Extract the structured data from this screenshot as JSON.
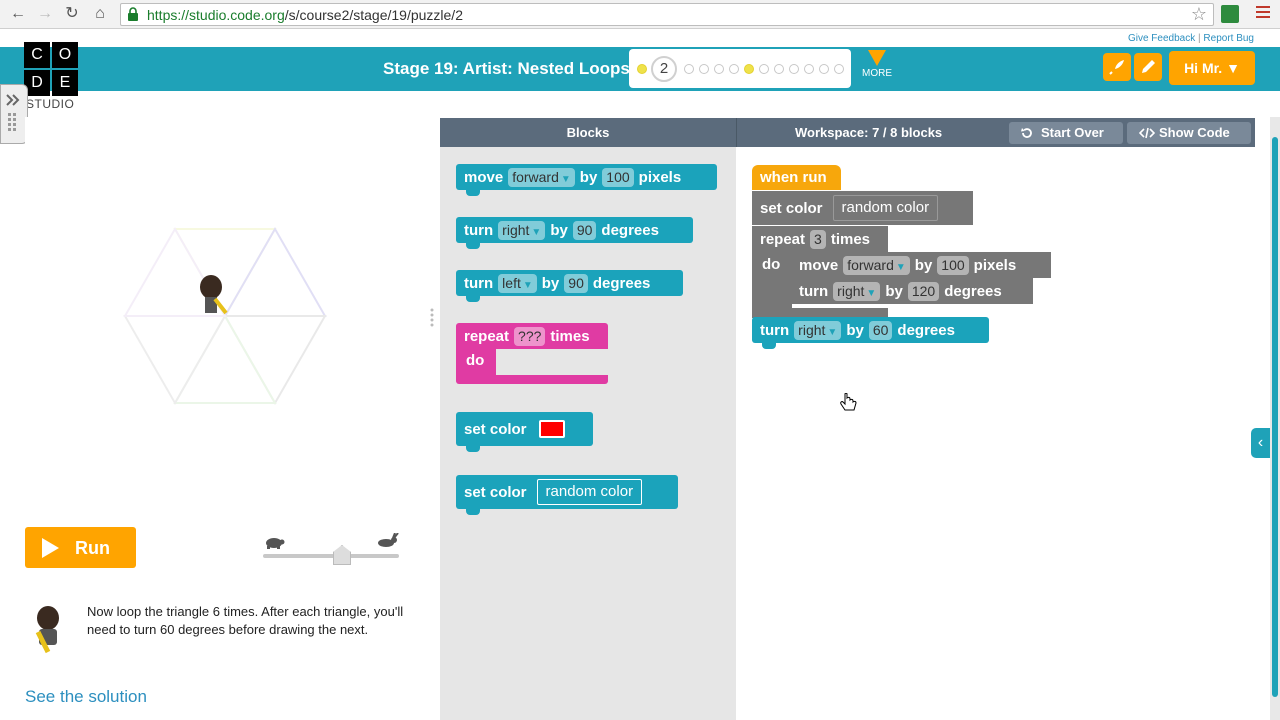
{
  "browser": {
    "url_host": "https://studio.code.org",
    "url_path": "/s/course2/stage/19/puzzle/2"
  },
  "header": {
    "give_feedback": "Give Feedback",
    "separator": "|",
    "report_bug": "Report Bug",
    "logo_letters": [
      "C",
      "O",
      "D",
      "E"
    ],
    "studio": "STUDIO",
    "stage_title": "Stage 19: Artist: Nested Loops",
    "current_puzzle": "2",
    "more": "MORE",
    "user_button": "Hi Mr. ▼"
  },
  "left_panel": {
    "run_label": "Run",
    "instructions": "Now loop the triangle 6 times. After each triangle, you'll need to turn 60 degrees before drawing the next.",
    "see_solution": "See the solution"
  },
  "toolbar": {
    "blocks_label": "Blocks",
    "workspace_label": "Workspace: 7 / 8 blocks",
    "start_over": "Start Over",
    "show_code": "Show Code"
  },
  "toolbox_blocks": {
    "move": {
      "word": "move",
      "dir": "forward",
      "by": "by",
      "amount": "100",
      "unit": "pixels"
    },
    "turn_right": {
      "word": "turn",
      "dir": "right",
      "by": "by",
      "amount": "90",
      "unit": "degrees"
    },
    "turn_left": {
      "word": "turn",
      "dir": "left",
      "by": "by",
      "amount": "90",
      "unit": "degrees"
    },
    "repeat": {
      "word": "repeat",
      "amount": "???",
      "unit": "times",
      "do": "do"
    },
    "set_color": {
      "word": "set color",
      "color": "#ff0000"
    },
    "set_color_random": {
      "word": "set color",
      "value": "random color"
    }
  },
  "workspace_blocks": {
    "when_run": "when run",
    "set_color": {
      "word": "set color",
      "value": "random color"
    },
    "repeat": {
      "word": "repeat",
      "amount": "3",
      "unit": "times",
      "do": "do"
    },
    "move": {
      "word": "move",
      "dir": "forward",
      "by": "by",
      "amount": "100",
      "unit": "pixels"
    },
    "turn_inner": {
      "word": "turn",
      "dir": "right",
      "by": "by",
      "amount": "120",
      "unit": "degrees"
    },
    "turn_outer": {
      "word": "turn",
      "dir": "right",
      "by": "by",
      "amount": "60",
      "unit": "degrees"
    }
  },
  "colors": {
    "header_teal": "#1fa2b8",
    "orange": "#ffa400",
    "block_teal": "#1ba3bb",
    "block_pink": "#e03ba3",
    "block_gray": "#777777"
  }
}
